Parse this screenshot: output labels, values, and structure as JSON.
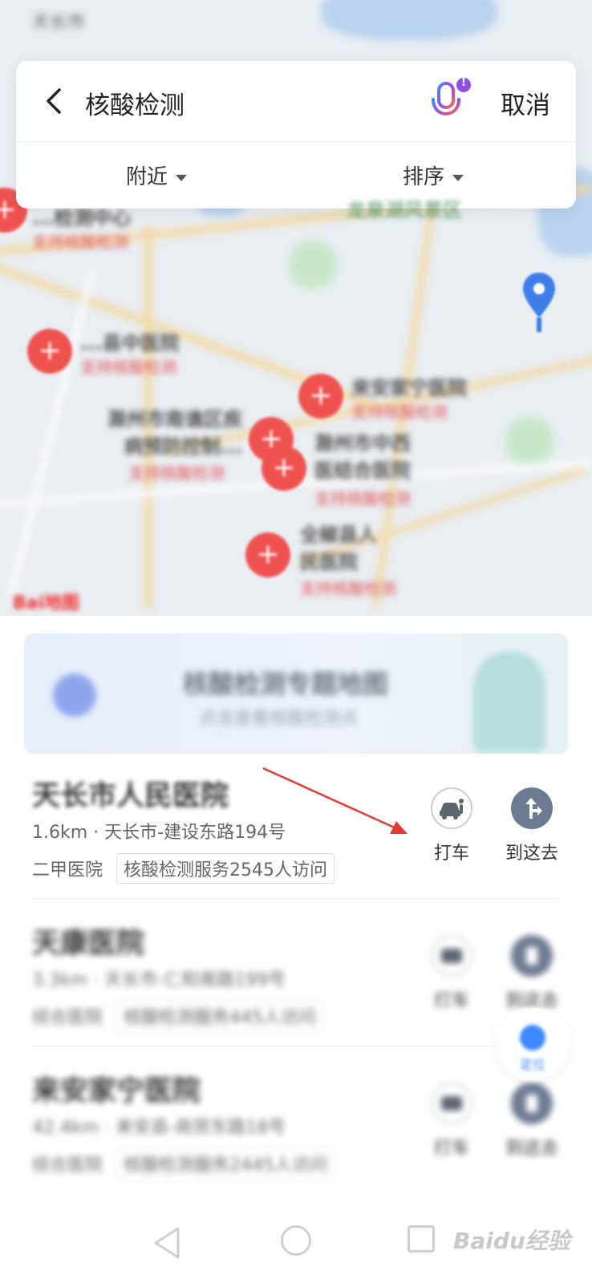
{
  "search": {
    "query": "核酸检测",
    "cancel_label": "取消",
    "voice_badge": "!"
  },
  "filters": {
    "nearby_label": "附近",
    "sort_label": "排序"
  },
  "map": {
    "scenic_label": "龙泉湖风景区",
    "pois": [
      {
        "name": "...检测中心",
        "sub": "支持核酸检测"
      },
      {
        "name": "...县中医院",
        "sub": "支持核酸检测"
      },
      {
        "name": "来安家宁医院",
        "sub": "支持核酸检测"
      },
      {
        "name": "滁州市南谯区疾病预防控制...",
        "sub": "支持核酸检测"
      },
      {
        "name": "滁州市中西医结合医院",
        "sub": "支持核酸检测"
      },
      {
        "name": "全椒县人民医院",
        "sub": "支持核酸检测"
      }
    ],
    "logo": "Bai地图"
  },
  "banner": {
    "title": "核酸检测专题地图",
    "subtitle": "点击查看核酸检测点"
  },
  "hospitals": [
    {
      "name": "天长市人民医院",
      "address": "1.6km · 天长市-建设东路194号",
      "type": "二甲医院",
      "visits": "核酸检测服务2545人访问",
      "taxi_label": "打车",
      "go_label": "到这去"
    },
    {
      "name": "天康医院",
      "address": "3.3km · 天长市-仁和南路199号",
      "type": "综合医院",
      "visits": "核酸检测服务445人访问",
      "taxi_label": "打车",
      "go_label": "到这去"
    },
    {
      "name": "来安家宁医院",
      "address": "42.4km · 来安县-商贸东路18号",
      "type": "综合医院",
      "visits": "核酸检测服务2445人访问",
      "taxi_label": "打车",
      "go_label": "到这去"
    }
  ],
  "locate_label": "定位",
  "watermark": "Baidu经验",
  "colors": {
    "accent_red": "#e53935",
    "poi_red": "#ef5350",
    "go_button": "#6c7a92",
    "mic_gradient": [
      "#3d8bff",
      "#a34bdc",
      "#ff6a3d"
    ]
  }
}
